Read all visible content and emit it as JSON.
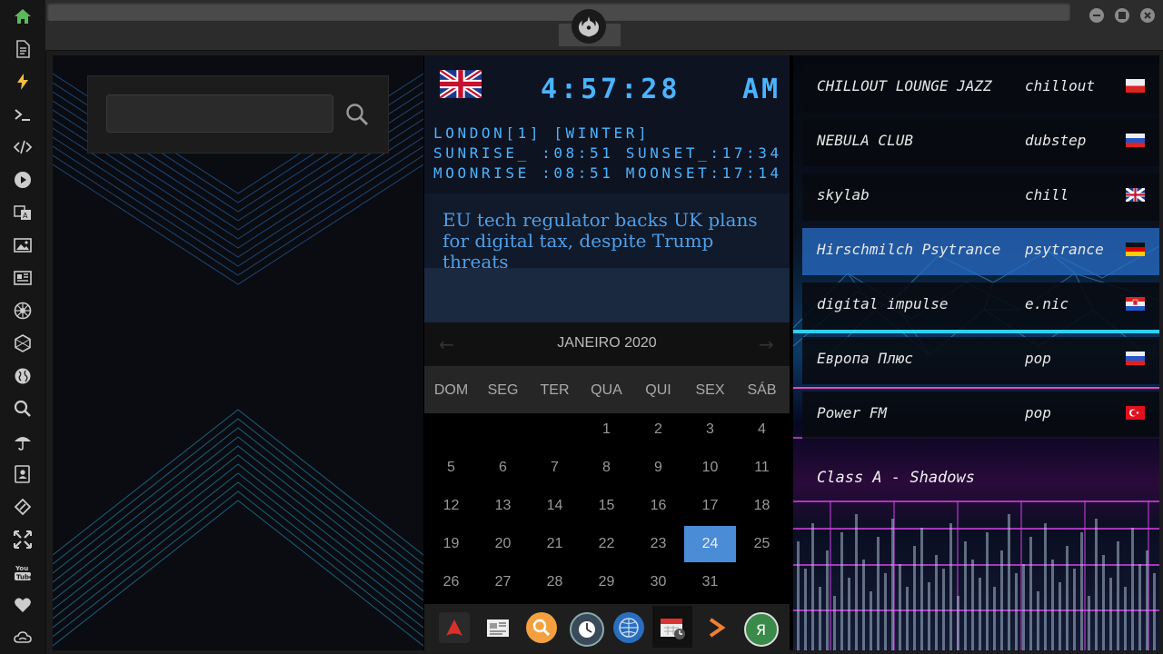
{
  "sidebar": {
    "items": [
      {
        "icon": "home-icon"
      },
      {
        "icon": "document-icon"
      },
      {
        "icon": "lightning-icon"
      },
      {
        "icon": "terminal-icon"
      },
      {
        "icon": "code-icon"
      },
      {
        "icon": "play-icon"
      },
      {
        "icon": "translate-icon"
      },
      {
        "icon": "image-icon"
      },
      {
        "icon": "newspaper-icon"
      },
      {
        "icon": "empire-icon"
      },
      {
        "icon": "hexagon-icon"
      },
      {
        "icon": "globe-icon"
      },
      {
        "icon": "search-icon"
      },
      {
        "icon": "umbrella-icon"
      },
      {
        "icon": "contacts-icon"
      },
      {
        "icon": "link-icon"
      },
      {
        "icon": "expand-icon"
      },
      {
        "icon": "youtube-icon"
      },
      {
        "icon": "heart-icon"
      },
      {
        "icon": "cloud-icon"
      }
    ]
  },
  "window": {
    "logo": "rebel-alliance-icon"
  },
  "search": {
    "value": "",
    "placeholder": ""
  },
  "clock": {
    "time": "4:57:28",
    "ampm": "AM",
    "location": "LONDON[1] [WINTER]",
    "sun": "SUNRISE_ :08:51 SUNSET_:17:34",
    "moon": "MOONRISE :08:51 MOONSET:17:14",
    "flag": "uk"
  },
  "news": {
    "headline": "EU tech regulator backs UK plans for digital tax, despite Trump threats"
  },
  "calendar": {
    "title": "JANEIRO 2020",
    "weekdays": [
      "DOM",
      "SEG",
      "TER",
      "QUA",
      "QUI",
      "SEX",
      "SÁB"
    ],
    "days": [
      [
        "",
        "",
        "",
        "1",
        "2",
        "3",
        "4"
      ],
      [
        "5",
        "6",
        "7",
        "8",
        "9",
        "10",
        "11"
      ],
      [
        "12",
        "13",
        "14",
        "15",
        "16",
        "17",
        "18"
      ],
      [
        "19",
        "20",
        "21",
        "22",
        "23",
        "24",
        "25"
      ],
      [
        "26",
        "27",
        "28",
        "29",
        "30",
        "31",
        ""
      ]
    ],
    "today": "24",
    "accent": "#4a8cd6"
  },
  "dock": {
    "items": [
      "arch-icon",
      "news-icon",
      "search-icon",
      "clock-icon",
      "web-icon",
      "calendar-icon",
      "play-arrow-icon",
      "yandex-icon"
    ]
  },
  "radio": {
    "stations": [
      {
        "name": "CHILLOUT LOUNGE JAZZ",
        "genre": "chillout",
        "flag": "pl"
      },
      {
        "name": "NEBULA CLUB",
        "genre": "dubstep",
        "flag": "ru"
      },
      {
        "name": "skylab",
        "genre": "chill",
        "flag": "uk"
      },
      {
        "name": "Hirschmilch Psytrance",
        "genre": "psytrance",
        "flag": "de"
      },
      {
        "name": "digital impulse",
        "genre": "e.nic",
        "flag": "hr"
      },
      {
        "name": "Европа Плюс",
        "genre": "pop",
        "flag": "ru"
      },
      {
        "name": "Power FM",
        "genre": "pop",
        "flag": "tr"
      }
    ],
    "active": 3,
    "now_playing": "Class A - Shadows"
  }
}
